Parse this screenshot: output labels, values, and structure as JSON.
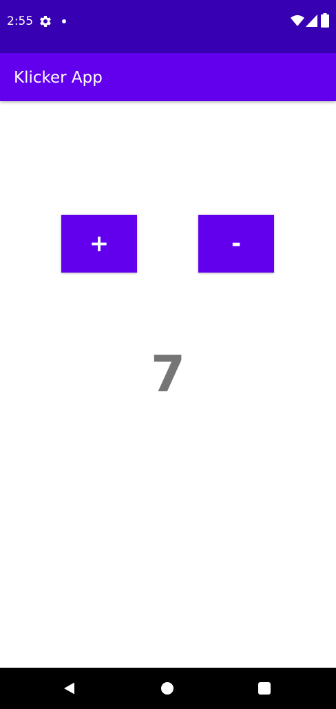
{
  "status_bar": {
    "time": "2:55",
    "icons": [
      "gear-icon",
      "notification-dot-icon",
      "wifi-icon",
      "cell-signal-icon",
      "battery-icon"
    ],
    "background": "#3700b3"
  },
  "app_bar": {
    "title": "Klicker App",
    "background": "#6200ee"
  },
  "buttons": {
    "increment_label": "+",
    "decrement_label": "-",
    "color": "#6200ee"
  },
  "counter": {
    "value": "7",
    "color": "#757575"
  },
  "nav_bar": {
    "icons": [
      "back-icon",
      "home-icon",
      "recents-icon"
    ]
  }
}
